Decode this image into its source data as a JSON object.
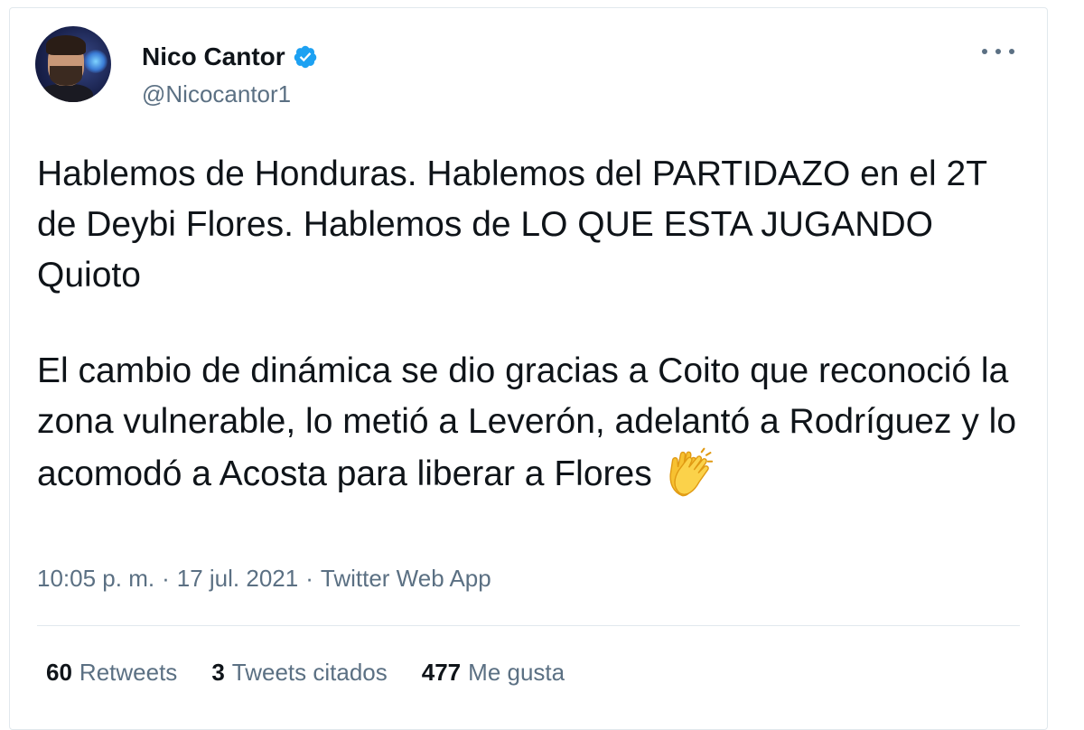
{
  "author": {
    "display_name": "Nico Cantor",
    "handle": "@Nicocantor1",
    "verified": true
  },
  "tweet": {
    "paragraphs": [
      "Hablemos de Honduras. Hablemos del PARTIDAZO en el 2T de Deybi Flores. Hablemos de LO QUE ESTA JUGANDO Quioto",
      "El cambio de dinámica se dio gracias a Coito que reconoció la zona vulnerable, lo metió a Leverón, adelantó a Rodríguez y lo acomodó a Acosta para liberar a Flores"
    ],
    "emoji": "clapping-hands-icon"
  },
  "meta": {
    "time": "10:05 p. m.",
    "separator": "·",
    "date": "17 jul. 2021",
    "source": "Twitter Web App"
  },
  "stats": {
    "retweets_count": "60",
    "retweets_label": "Retweets",
    "quotes_count": "3",
    "quotes_label": "Tweets citados",
    "likes_count": "477",
    "likes_label": "Me gusta"
  },
  "colors": {
    "text": "#0f1419",
    "secondary": "#5b7083",
    "verified": "#1da1f2",
    "border": "#e1e8ed"
  }
}
